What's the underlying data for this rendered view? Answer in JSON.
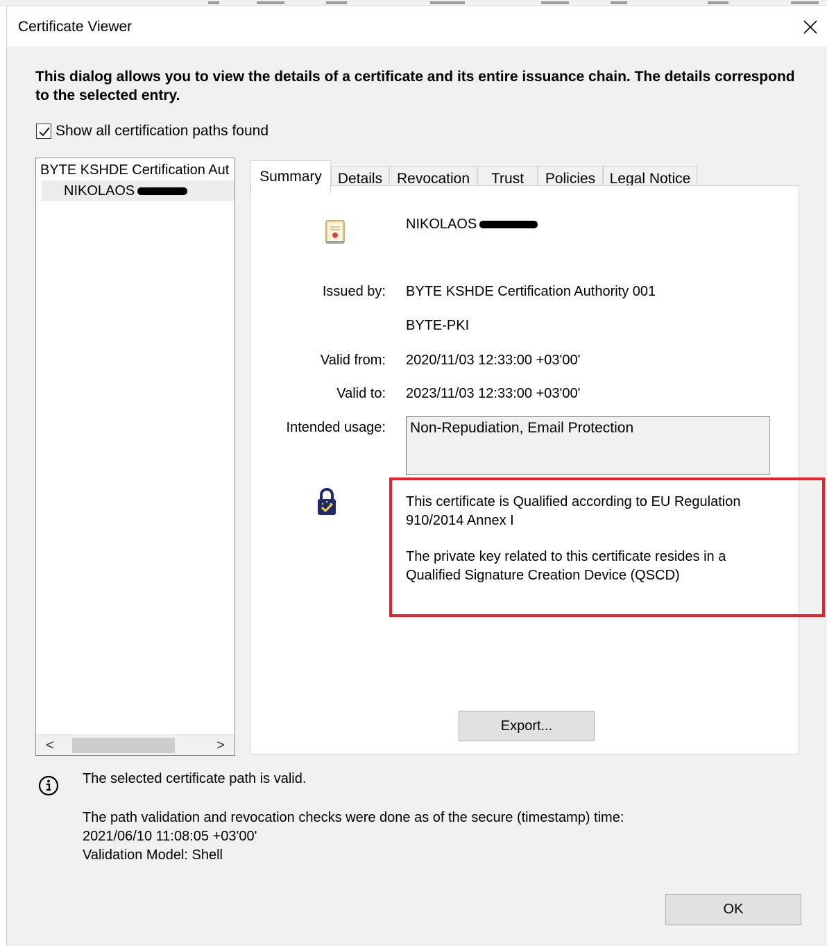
{
  "window": {
    "title": "Certificate Viewer",
    "close_icon": "close-icon"
  },
  "intro_text": "This dialog allows you to view the details of a certificate and its entire issuance chain. The details correspond to the selected entry.",
  "show_paths": {
    "label": "Show all certification paths found",
    "checked": true
  },
  "tree": {
    "items": [
      {
        "label": "BYTE KSHDE Certification Aut"
      },
      {
        "label": "NIKOLAOS"
      }
    ]
  },
  "scrollbar": {
    "left_arrow": "<",
    "right_arrow": ">"
  },
  "tabs": [
    {
      "label": "Summary",
      "active": true
    },
    {
      "label": "Details"
    },
    {
      "label": "Revocation"
    },
    {
      "label": "Trust"
    },
    {
      "label": "Policies"
    },
    {
      "label": "Legal Notice"
    }
  ],
  "summary": {
    "subject_name": "NIKOLAOS",
    "fields": {
      "issued_by_label": "Issued by:",
      "issued_by_value": "BYTE KSHDE Certification Authority 001",
      "issued_by_org": "BYTE-PKI",
      "valid_from_label": "Valid from:",
      "valid_from_value": "2020/11/03 12:33:00 +03'00'",
      "valid_to_label": "Valid to:",
      "valid_to_value": "2023/11/03 12:33:00 +03'00'",
      "intended_usage_label": "Intended usage:",
      "intended_usage_value": "Non-Repudiation, Email Protection"
    },
    "qualified_line1": "This certificate is Qualified according to EU Regulation 910/2014 Annex I",
    "qualified_line2": "The private key related to this certificate resides in a Qualified Signature Creation Device (QSCD)",
    "export_label": "Export..."
  },
  "status": {
    "valid_text": "The selected certificate path is valid.",
    "check_text": "The path validation and revocation checks were done as of the secure (timestamp) time:",
    "timestamp": "2021/06/10 11:08:05 +03'00'",
    "model": "Validation Model: Shell"
  },
  "buttons": {
    "ok_label": "OK"
  },
  "colors": {
    "highlight_border": "#e8202a",
    "dialog_bg": "#f0f0f0",
    "panel_bg": "#ffffff"
  }
}
